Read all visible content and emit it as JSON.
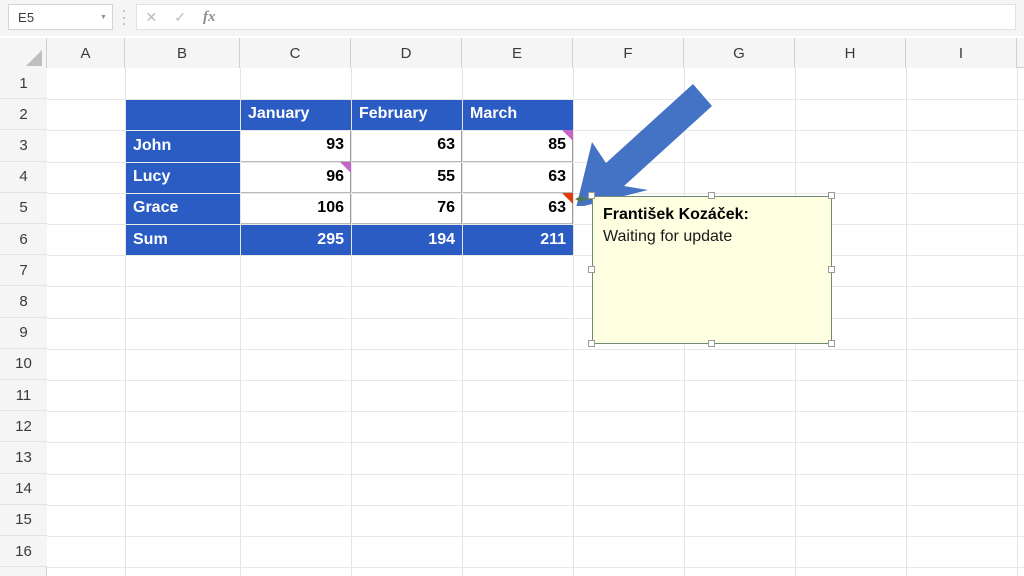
{
  "app": {
    "name": "excel-spreadsheet"
  },
  "formula_bar": {
    "name_box_value": "E5",
    "name_box_dropdown_icon": "chevron-down-icon",
    "cancel_icon": "✕",
    "enter_icon": "✓",
    "function_icon": "fx",
    "formula_value": "",
    "formula_placeholder": ""
  },
  "grid": {
    "columns": [
      "A",
      "B",
      "C",
      "D",
      "E",
      "F",
      "G",
      "H",
      "I"
    ],
    "rows": [
      "1",
      "2",
      "3",
      "4",
      "5",
      "6",
      "7",
      "8",
      "9",
      "10",
      "11",
      "12",
      "13",
      "14",
      "15",
      "16"
    ]
  },
  "table": {
    "header_row": [
      "",
      "January",
      "February",
      "March"
    ],
    "data_rows": [
      {
        "label": "John",
        "values": [
          "93",
          "63",
          "85"
        ]
      },
      {
        "label": "Lucy",
        "values": [
          "96",
          "55",
          "63"
        ]
      },
      {
        "label": "Grace",
        "values": [
          "106",
          "76",
          "63"
        ]
      }
    ],
    "total_row": {
      "label": "Sum",
      "values": [
        "295",
        "194",
        "211"
      ]
    },
    "header_fill": "#2B5CC4",
    "header_text_color": "#FFFFFF"
  },
  "markers": [
    {
      "cell": "E3",
      "type": "magenta-note-marker",
      "color": "#C466C4"
    },
    {
      "cell": "C4",
      "type": "magenta-note-marker",
      "color": "#C466C4"
    },
    {
      "cell": "E5",
      "type": "red-comment-marker",
      "color": "#E03A10"
    }
  ],
  "comment": {
    "author": "František Kozáček:",
    "body": "Waiting for update",
    "background": "#FEFEE1",
    "border_color": "#6E8B74",
    "selected": true,
    "anchor_cell": "E5"
  },
  "annotation": {
    "arrow": "blue-down-left-arrow",
    "color": "#4472C4",
    "points_to": "E5"
  }
}
